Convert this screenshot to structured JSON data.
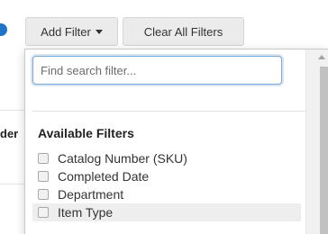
{
  "toolbar": {
    "add_filter_label": "Add Filter",
    "clear_all_label": "Clear All Filters"
  },
  "background": {
    "partial_text": "der"
  },
  "dropdown": {
    "search_placeholder": "Find search filter...",
    "section_title": "Available Filters",
    "filters": [
      {
        "label": "Catalog Number (SKU)",
        "checked": false
      },
      {
        "label": "Completed Date",
        "checked": false
      },
      {
        "label": "Department",
        "checked": false
      },
      {
        "label": "Item Type",
        "checked": false,
        "hovered": true
      }
    ]
  },
  "colors": {
    "accent": "#1e74c8",
    "focus_border": "#7aa9d6",
    "button_bg": "#ebebeb"
  }
}
